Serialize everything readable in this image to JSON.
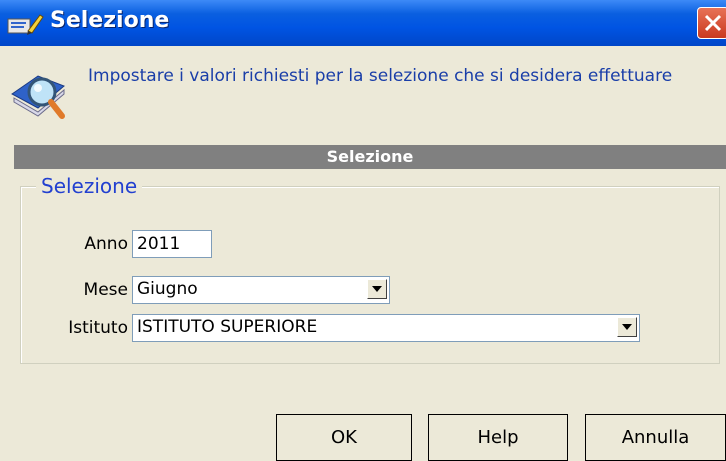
{
  "window": {
    "title": "Selezione"
  },
  "header": {
    "instructions": "Impostare i valori richiesti per la selezione che si desidera effettuare"
  },
  "section": {
    "title": "Selezione"
  },
  "group": {
    "legend": "Selezione"
  },
  "form": {
    "anno": {
      "label": "Anno",
      "value": "2011"
    },
    "mese": {
      "label": "Mese",
      "value": "Giugno"
    },
    "istituto": {
      "label": "Istituto",
      "value": "ISTITUTO SUPERIORE"
    }
  },
  "buttons": {
    "ok": "OK",
    "help": "Help",
    "annulla": "Annulla"
  },
  "colors": {
    "titlebar": "#0054e3",
    "dialog_bg": "#ece9d8",
    "legend": "#2240d0",
    "section_bar": "#808080"
  }
}
